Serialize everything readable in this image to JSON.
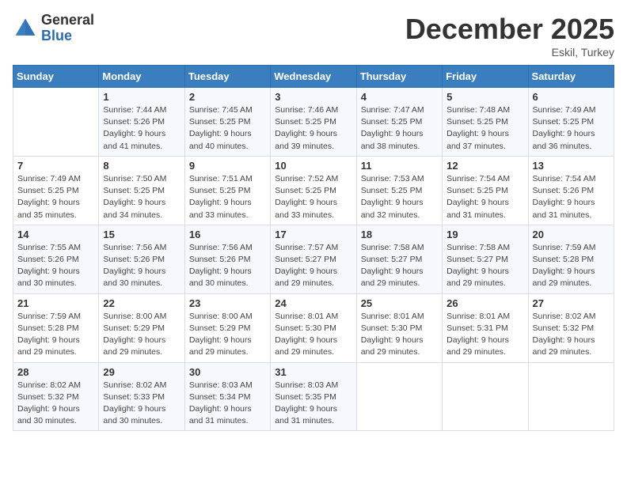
{
  "header": {
    "logo_general": "General",
    "logo_blue": "Blue",
    "month_title": "December 2025",
    "location": "Eskil, Turkey"
  },
  "weekdays": [
    "Sunday",
    "Monday",
    "Tuesday",
    "Wednesday",
    "Thursday",
    "Friday",
    "Saturday"
  ],
  "weeks": [
    [
      {
        "day": "",
        "info": ""
      },
      {
        "day": "1",
        "info": "Sunrise: 7:44 AM\nSunset: 5:26 PM\nDaylight: 9 hours\nand 41 minutes."
      },
      {
        "day": "2",
        "info": "Sunrise: 7:45 AM\nSunset: 5:25 PM\nDaylight: 9 hours\nand 40 minutes."
      },
      {
        "day": "3",
        "info": "Sunrise: 7:46 AM\nSunset: 5:25 PM\nDaylight: 9 hours\nand 39 minutes."
      },
      {
        "day": "4",
        "info": "Sunrise: 7:47 AM\nSunset: 5:25 PM\nDaylight: 9 hours\nand 38 minutes."
      },
      {
        "day": "5",
        "info": "Sunrise: 7:48 AM\nSunset: 5:25 PM\nDaylight: 9 hours\nand 37 minutes."
      },
      {
        "day": "6",
        "info": "Sunrise: 7:49 AM\nSunset: 5:25 PM\nDaylight: 9 hours\nand 36 minutes."
      }
    ],
    [
      {
        "day": "7",
        "info": "Sunrise: 7:49 AM\nSunset: 5:25 PM\nDaylight: 9 hours\nand 35 minutes."
      },
      {
        "day": "8",
        "info": "Sunrise: 7:50 AM\nSunset: 5:25 PM\nDaylight: 9 hours\nand 34 minutes."
      },
      {
        "day": "9",
        "info": "Sunrise: 7:51 AM\nSunset: 5:25 PM\nDaylight: 9 hours\nand 33 minutes."
      },
      {
        "day": "10",
        "info": "Sunrise: 7:52 AM\nSunset: 5:25 PM\nDaylight: 9 hours\nand 33 minutes."
      },
      {
        "day": "11",
        "info": "Sunrise: 7:53 AM\nSunset: 5:25 PM\nDaylight: 9 hours\nand 32 minutes."
      },
      {
        "day": "12",
        "info": "Sunrise: 7:54 AM\nSunset: 5:25 PM\nDaylight: 9 hours\nand 31 minutes."
      },
      {
        "day": "13",
        "info": "Sunrise: 7:54 AM\nSunset: 5:26 PM\nDaylight: 9 hours\nand 31 minutes."
      }
    ],
    [
      {
        "day": "14",
        "info": "Sunrise: 7:55 AM\nSunset: 5:26 PM\nDaylight: 9 hours\nand 30 minutes."
      },
      {
        "day": "15",
        "info": "Sunrise: 7:56 AM\nSunset: 5:26 PM\nDaylight: 9 hours\nand 30 minutes."
      },
      {
        "day": "16",
        "info": "Sunrise: 7:56 AM\nSunset: 5:26 PM\nDaylight: 9 hours\nand 30 minutes."
      },
      {
        "day": "17",
        "info": "Sunrise: 7:57 AM\nSunset: 5:27 PM\nDaylight: 9 hours\nand 29 minutes."
      },
      {
        "day": "18",
        "info": "Sunrise: 7:58 AM\nSunset: 5:27 PM\nDaylight: 9 hours\nand 29 minutes."
      },
      {
        "day": "19",
        "info": "Sunrise: 7:58 AM\nSunset: 5:27 PM\nDaylight: 9 hours\nand 29 minutes."
      },
      {
        "day": "20",
        "info": "Sunrise: 7:59 AM\nSunset: 5:28 PM\nDaylight: 9 hours\nand 29 minutes."
      }
    ],
    [
      {
        "day": "21",
        "info": "Sunrise: 7:59 AM\nSunset: 5:28 PM\nDaylight: 9 hours\nand 29 minutes."
      },
      {
        "day": "22",
        "info": "Sunrise: 8:00 AM\nSunset: 5:29 PM\nDaylight: 9 hours\nand 29 minutes."
      },
      {
        "day": "23",
        "info": "Sunrise: 8:00 AM\nSunset: 5:29 PM\nDaylight: 9 hours\nand 29 minutes."
      },
      {
        "day": "24",
        "info": "Sunrise: 8:01 AM\nSunset: 5:30 PM\nDaylight: 9 hours\nand 29 minutes."
      },
      {
        "day": "25",
        "info": "Sunrise: 8:01 AM\nSunset: 5:30 PM\nDaylight: 9 hours\nand 29 minutes."
      },
      {
        "day": "26",
        "info": "Sunrise: 8:01 AM\nSunset: 5:31 PM\nDaylight: 9 hours\nand 29 minutes."
      },
      {
        "day": "27",
        "info": "Sunrise: 8:02 AM\nSunset: 5:32 PM\nDaylight: 9 hours\nand 29 minutes."
      }
    ],
    [
      {
        "day": "28",
        "info": "Sunrise: 8:02 AM\nSunset: 5:32 PM\nDaylight: 9 hours\nand 30 minutes."
      },
      {
        "day": "29",
        "info": "Sunrise: 8:02 AM\nSunset: 5:33 PM\nDaylight: 9 hours\nand 30 minutes."
      },
      {
        "day": "30",
        "info": "Sunrise: 8:03 AM\nSunset: 5:34 PM\nDaylight: 9 hours\nand 31 minutes."
      },
      {
        "day": "31",
        "info": "Sunrise: 8:03 AM\nSunset: 5:35 PM\nDaylight: 9 hours\nand 31 minutes."
      },
      {
        "day": "",
        "info": ""
      },
      {
        "day": "",
        "info": ""
      },
      {
        "day": "",
        "info": ""
      }
    ]
  ]
}
